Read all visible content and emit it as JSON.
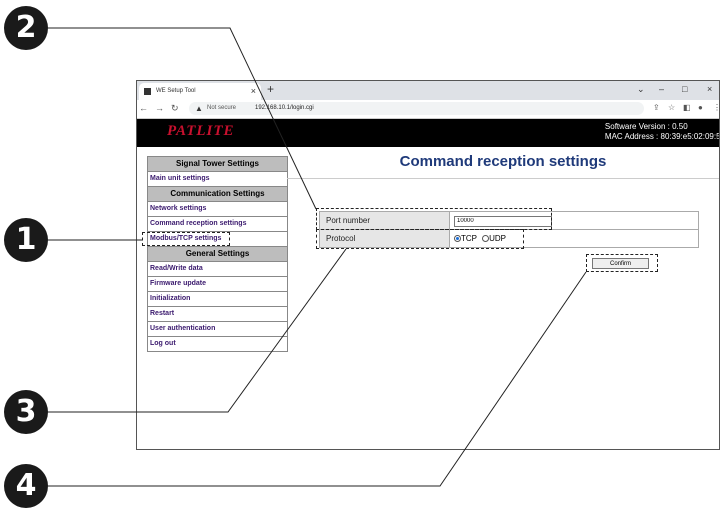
{
  "callouts": [
    "2",
    "1",
    "3",
    "4"
  ],
  "browser": {
    "tab_title": "WE Setup Tool",
    "tab_close": "×",
    "new_tab": "+",
    "win_min": "–",
    "win_max": "□",
    "win_close": "×",
    "win_chevron": "⌄",
    "not_secure": "Not secure",
    "url": "192.168.10.1/login.cgi"
  },
  "app": {
    "logo": "PATLITE",
    "software_version": "Software Version : 0.50",
    "mac_address": "MAC Address : 80:39:e5:02:09:58"
  },
  "sidebar": {
    "sections": [
      {
        "header": "Signal Tower Settings",
        "items": [
          "Main unit settings"
        ]
      },
      {
        "header": "Communication Settings",
        "items": [
          "Network settings",
          "Command reception settings",
          "Modbus/TCP settings"
        ]
      },
      {
        "header": "General Settings",
        "items": [
          "Read/Write data",
          "Firmware update",
          "Initialization",
          "Restart",
          "User authentication",
          "Log out"
        ]
      }
    ]
  },
  "main": {
    "title": "Command reception settings",
    "port_label": "Port number",
    "port_value": "10000",
    "protocol_label": "Protocol",
    "protocol_options": [
      "TCP",
      "UDP"
    ],
    "protocol_selected": "TCP",
    "confirm_label": "Confirm"
  },
  "icons": {
    "back": "back-arrow-icon",
    "forward": "forward-arrow-icon",
    "reload": "reload-icon",
    "warning": "warning-icon",
    "share": "share-icon",
    "star": "star-icon",
    "sidepanel": "side-panel-icon",
    "profile": "profile-icon",
    "menu": "menu-icon"
  },
  "colors": {
    "title_blue": "#1f3a7a",
    "sidebar_link": "#3b1a6e",
    "logo_red": "#c8102e",
    "header_bg": "#000000"
  }
}
